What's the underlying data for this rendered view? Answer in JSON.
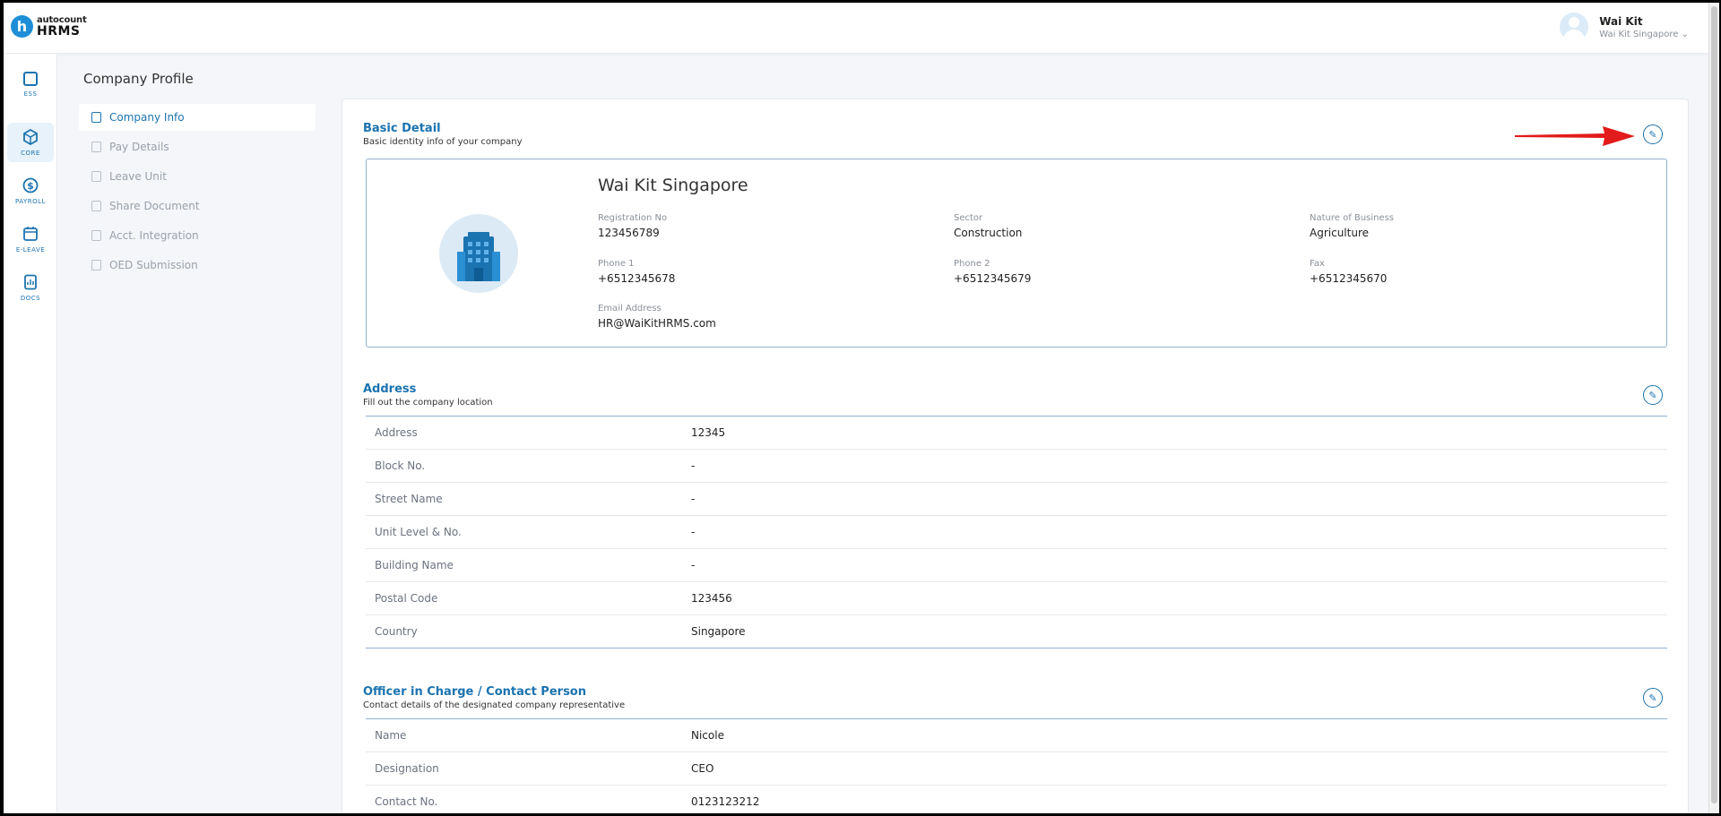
{
  "app": {
    "logo_top": "autocount",
    "logo_bottom": "HRMS",
    "logo_letter": "h"
  },
  "user": {
    "name": "Wai Kit",
    "company": "Wai Kit Singapore ⌄"
  },
  "rail": [
    {
      "label": "ESS",
      "icon": "ess-icon"
    },
    {
      "label": "CORE",
      "icon": "core-icon"
    },
    {
      "label": "PAYROLL",
      "icon": "payroll-icon"
    },
    {
      "label": "E-LEAVE",
      "icon": "calendar-icon"
    },
    {
      "label": "DOCS",
      "icon": "docs-icon"
    }
  ],
  "page_title": "Company Profile",
  "subnav": [
    {
      "label": "Company Info",
      "icon": "building-icon"
    },
    {
      "label": "Pay Details",
      "icon": "document-icon"
    },
    {
      "label": "Leave Unit",
      "icon": "calendar-icon"
    },
    {
      "label": "Share Document",
      "icon": "share-document-icon"
    },
    {
      "label": "Acct. Integration",
      "icon": "integration-icon"
    },
    {
      "label": "OED Submission",
      "icon": "submission-icon"
    }
  ],
  "basic": {
    "title": "Basic Detail",
    "subtitle": "Basic identity info of your company",
    "company_name": "Wai Kit Singapore",
    "fields": {
      "registration_no": {
        "label": "Registration No",
        "value": "123456789"
      },
      "sector": {
        "label": "Sector",
        "value": "Construction"
      },
      "nature": {
        "label": "Nature of Business",
        "value": "Agriculture"
      },
      "phone1": {
        "label": "Phone 1",
        "value": "+6512345678"
      },
      "phone2": {
        "label": "Phone 2",
        "value": "+6512345679"
      },
      "fax": {
        "label": "Fax",
        "value": "+6512345670"
      },
      "email": {
        "label": "Email Address",
        "value": "HR@WaiKitHRMS.com"
      }
    }
  },
  "address": {
    "title": "Address",
    "subtitle": "Fill out the company location",
    "rows": [
      {
        "key": "Address",
        "value": "12345"
      },
      {
        "key": "Block No.",
        "value": "-"
      },
      {
        "key": "Street Name",
        "value": "-"
      },
      {
        "key": "Unit Level & No.",
        "value": "-"
      },
      {
        "key": "Building Name",
        "value": "-"
      },
      {
        "key": "Postal Code",
        "value": "123456"
      },
      {
        "key": "Country",
        "value": "Singapore"
      }
    ]
  },
  "officer": {
    "title": "Officer in Charge / Contact Person",
    "subtitle": "Contact details of the designated company representative",
    "rows": [
      {
        "key": "Name",
        "value": "Nicole"
      },
      {
        "key": "Designation",
        "value": "CEO"
      },
      {
        "key": "Contact No.",
        "value": "0123123212"
      }
    ]
  },
  "edit_glyph": "✎",
  "colors": {
    "accent": "#1b73b0",
    "arrow": "#e21b1b"
  }
}
